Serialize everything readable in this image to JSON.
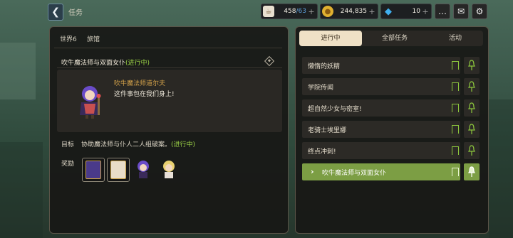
{
  "header": {
    "breadcrumb": "任务",
    "back_icon": "back-arrow-icon"
  },
  "resources": [
    {
      "id": "stamina",
      "icon": "coffee-cup-icon",
      "value": "458",
      "max": "/63",
      "color": "#5b9bd5"
    },
    {
      "id": "gold",
      "icon": "gold-coin-icon",
      "value": "244,835",
      "color": "#e0b030"
    },
    {
      "id": "gem",
      "icon": "blue-gem-icon",
      "value": "10",
      "color": "#40b0f0"
    }
  ],
  "toolbar": {
    "chat_icon": "chat-bubble-icon",
    "mail_icon": "mail-icon",
    "settings_icon": "gear-icon"
  },
  "left_panel": {
    "world_tab": "世界6",
    "location_tab": "旅馆",
    "quest_title": "吹牛魔法师与双面女仆",
    "quest_status": "(进行中)",
    "speaker": "吹牛魔法师道尔夫",
    "speech": "这件事包在我们身上!",
    "objective_label": "目标",
    "objective_text": "协助魔法师与仆人二人组破案。",
    "objective_status": "(进行中)",
    "reward_label": "奖励"
  },
  "right_panel": {
    "tabs": [
      {
        "label": "进行中",
        "active": true
      },
      {
        "label": "全部任务",
        "active": false
      },
      {
        "label": "活动",
        "active": false
      }
    ],
    "quests": [
      {
        "name": "懒惰的妖精",
        "active": false
      },
      {
        "name": "学院传闻",
        "active": false
      },
      {
        "name": "超自然少女与密室!",
        "active": false
      },
      {
        "name": "老骑士埃里娜",
        "active": false
      },
      {
        "name": "终点冲刺!",
        "active": false
      },
      {
        "name": "吹牛魔法师与双面女仆",
        "active": true
      }
    ]
  },
  "colors": {
    "accent_green": "#7c9e44",
    "progress_green": "#9ad046",
    "panel_bg": "#181816"
  }
}
